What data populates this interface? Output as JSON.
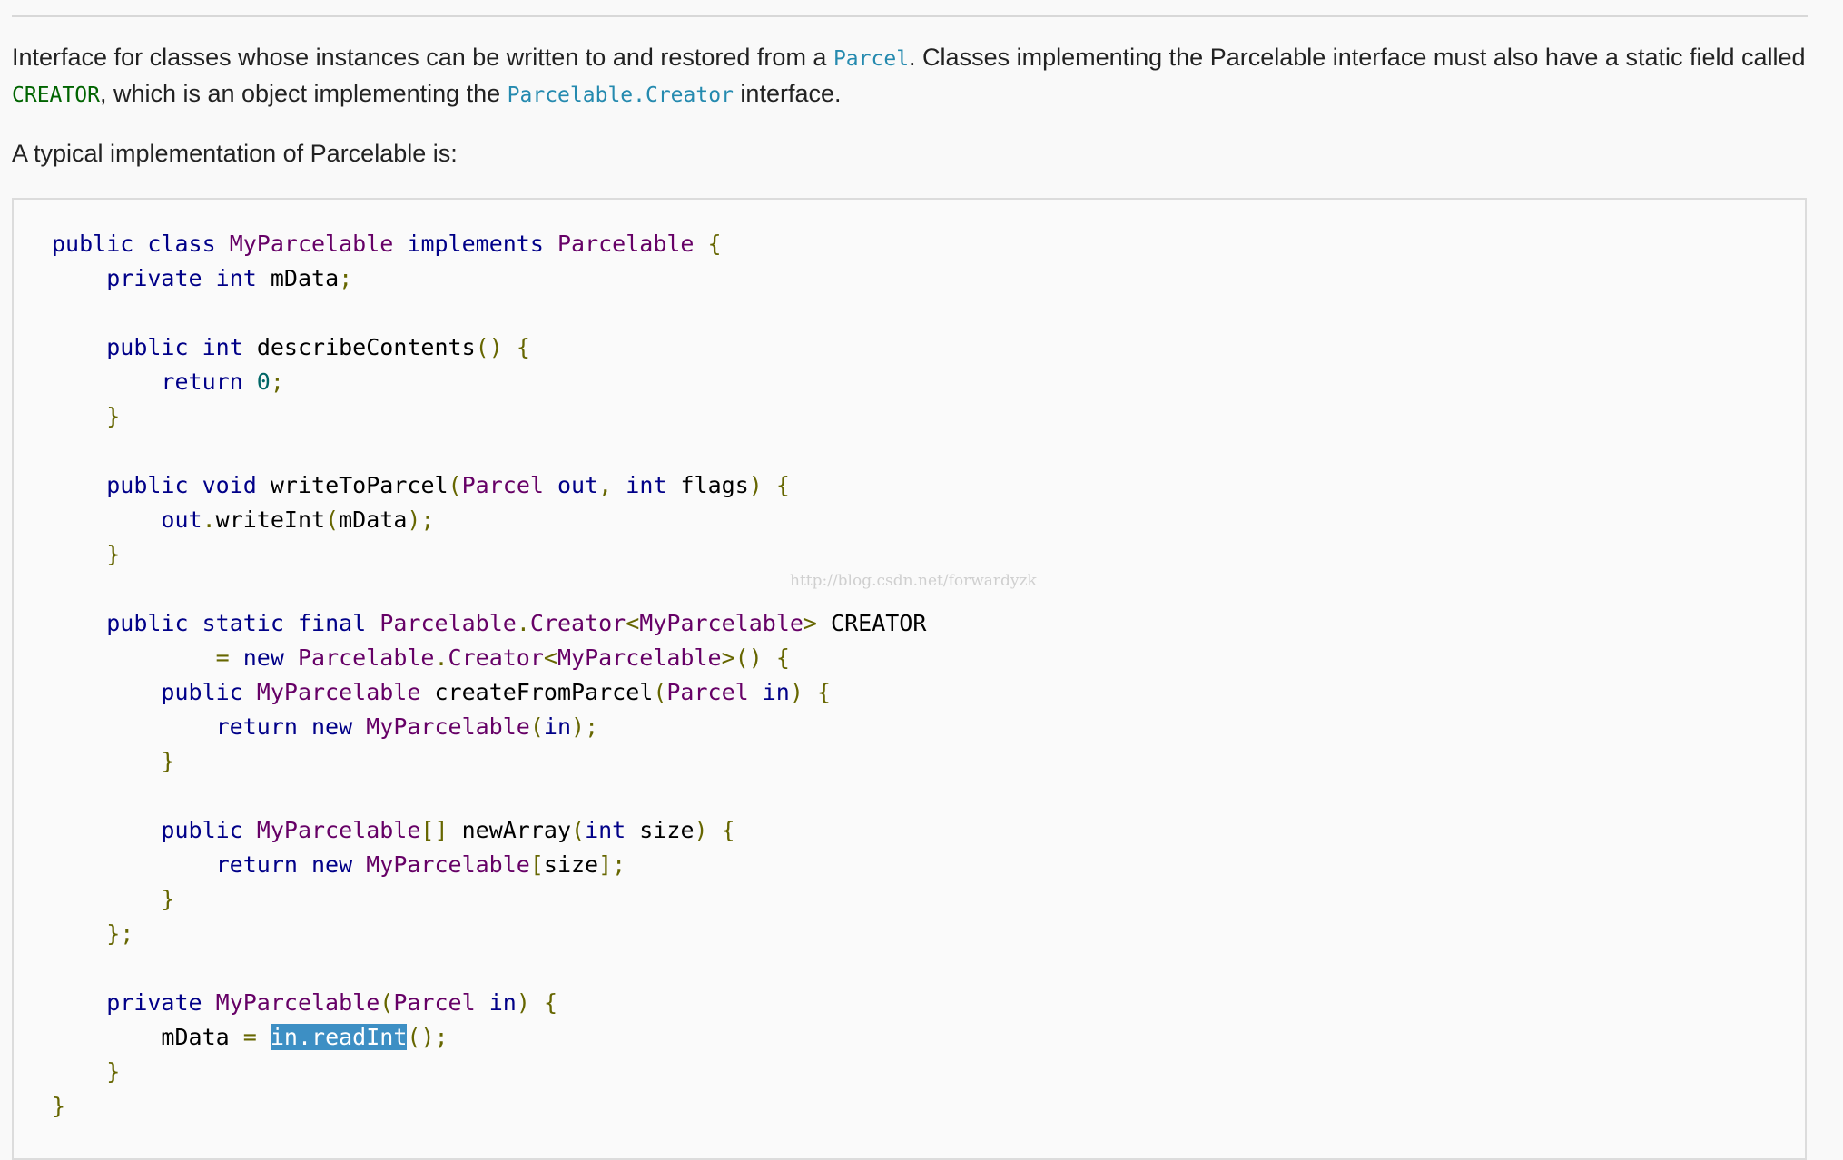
{
  "paragraph1": {
    "t1": "Interface for classes whose instances can be written to and restored from a ",
    "link1": "Parcel",
    "t2": ". Classes implementing the Parcelable interface must also have a static field called ",
    "code1": "CREATOR",
    "t3": ", which is an object implementing the ",
    "link2": "Parcelable.Creator",
    "t4": " interface."
  },
  "paragraph2": {
    "text": "A typical implementation of Parcelable is:"
  },
  "code": {
    "l1": {
      "a": "public",
      "b": "class",
      "c": "MyParcelable",
      "d": "implements",
      "e": "Parcelable",
      "f": "{"
    },
    "l2": {
      "a": "private",
      "b": "int",
      "c": "mData",
      "d": ";"
    },
    "l4": {
      "a": "public",
      "b": "int",
      "c": "describeContents",
      "d": "()",
      "e": "{"
    },
    "l5": {
      "a": "return",
      "b": "0",
      "c": ";"
    },
    "l6": {
      "a": "}"
    },
    "l8": {
      "a": "public",
      "b": "void",
      "c": "writeToParcel",
      "d": "(",
      "e": "Parcel",
      "f": "out",
      ",": ",",
      "g": "int",
      "h": "flags",
      "i": ")",
      "j": "{"
    },
    "l9": {
      "a": "out",
      "b": ".",
      "c": "writeInt",
      "d": "(",
      "e": "mData",
      "f": ");"
    },
    "l10": {
      "a": "}"
    },
    "l12": {
      "a": "public",
      "b": "static",
      "c": "final",
      "d": "Parcelable",
      "e": ".",
      "f": "Creator",
      "g": "<",
      "h": "MyParcelable",
      "i": ">",
      "j": "CREATOR"
    },
    "l13": {
      "a": "=",
      "b": "new",
      "c": "Parcelable",
      "d": ".",
      "e": "Creator",
      "f": "<",
      "g": "MyParcelable",
      "h": ">()",
      "i": "{"
    },
    "l14": {
      "a": "public",
      "b": "MyParcelable",
      "c": "createFromParcel",
      "d": "(",
      "e": "Parcel",
      "f": "in",
      "g": ")",
      "h": "{"
    },
    "l15": {
      "a": "return",
      "b": "new",
      "c": "MyParcelable",
      "d": "(",
      "e": "in",
      "f": ");"
    },
    "l16": {
      "a": "}"
    },
    "l18": {
      "a": "public",
      "b": "MyParcelable",
      "c": "[]",
      "d": "newArray",
      "e": "(",
      "f": "int",
      "g": "size",
      "h": ")",
      "i": "{"
    },
    "l19": {
      "a": "return",
      "b": "new",
      "c": "MyParcelable",
      "d": "[",
      "e": "size",
      "f": "];"
    },
    "l20": {
      "a": "}"
    },
    "l21": {
      "a": "};"
    },
    "l23": {
      "a": "private",
      "b": "MyParcelable",
      "c": "(",
      "d": "Parcel",
      "e": "in",
      "f": ")",
      "g": "{"
    },
    "l24": {
      "a": "mData",
      "b": "=",
      "c": "in.readInt",
      "d": "();"
    },
    "l25": {
      "a": "}"
    },
    "l26": {
      "a": "}"
    }
  },
  "watermark": "http://blog.csdn.net/forwardyzk"
}
